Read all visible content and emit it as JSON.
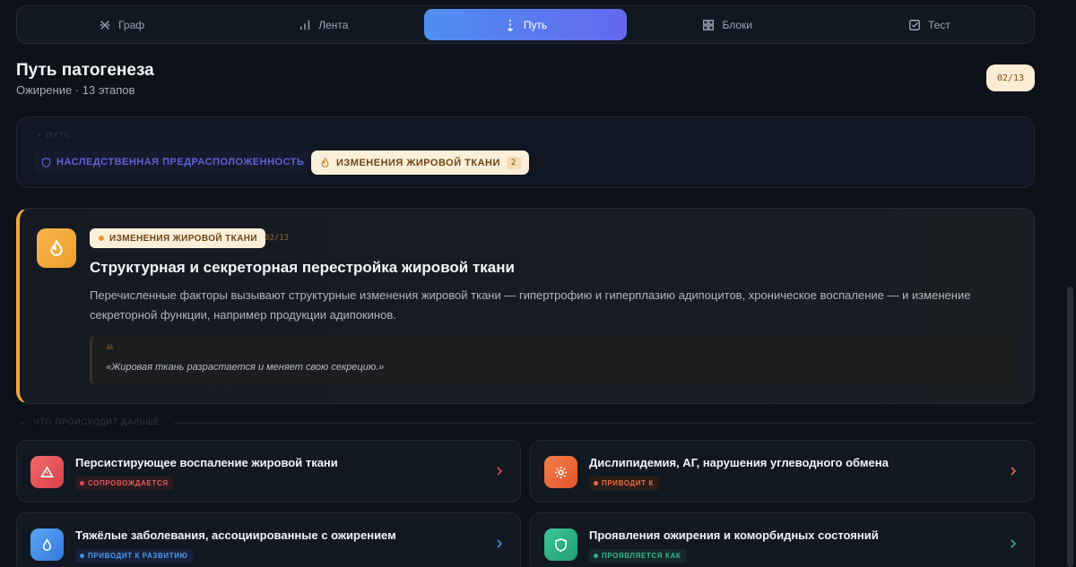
{
  "tabs": [
    {
      "label": "Граф",
      "icon": "graph-icon",
      "active": false
    },
    {
      "label": "Лента",
      "icon": "bar-chart-icon",
      "active": false
    },
    {
      "label": "Путь",
      "icon": "path-icon",
      "active": true
    },
    {
      "label": "Блоки",
      "icon": "grid-icon",
      "active": false
    },
    {
      "label": "Тест",
      "icon": "checkbox-icon",
      "active": false
    }
  ],
  "header": {
    "title": "Путь патогенеза",
    "subtitle": "Ожирение · 13 этапов",
    "counter": "02/13"
  },
  "path": {
    "label": "ПУТЬ",
    "crumbs": [
      {
        "label": "НАСЛЕДСТВЕННАЯ ПРЕДРАСПОЛОЖЕННОСТЬ",
        "icon": "shield-icon",
        "color": "#5e62d8"
      },
      {
        "label": "ИЗМЕНЕНИЯ ЖИРОВОЙ ТКАНИ",
        "icon": "flame-icon",
        "count": "2",
        "color": "#c77d24"
      }
    ]
  },
  "stage": {
    "icon": "flame-icon",
    "badge": "ИЗМЕНЕНИЯ ЖИРОВОЙ ТКАНИ",
    "number": "02/13",
    "title": "Структурная и секреторная перестройка жировой ткани",
    "text": "Перечисленные факторы вызывают структурные изменения жировой ткани — гипертрофию и гиперплазию адипоцитов, хроническое воспаление — и изменение секреторной функции, например продукции адипокинов.",
    "quote_mark": "❝",
    "quote": "«Жировая ткань разрастается и меняет свою секрецию.»",
    "accent": "#f0a63a"
  },
  "next": {
    "label": "ЧТО ПРОИСХОДИТ ДАЛЬШЕ",
    "items": [
      {
        "title": "Персистирующее воспаление жировой ткани",
        "badge": "СОПРОВОЖДАЕТСЯ",
        "icon": "warning-icon",
        "color": "#e04a4a"
      },
      {
        "title": "Дислипидемия, АГ, нарушения углеводного обмена",
        "badge": "ПРИВОДИТ К",
        "icon": "sun-icon",
        "color": "#ef6a3a"
      },
      {
        "title": "Тяжёлые заболевания, ассоциированные с ожирением",
        "badge": "ПРИВОДИТ К РАЗВИТИЮ",
        "icon": "drop-icon",
        "color": "#3d8ee8"
      },
      {
        "title": "Проявления ожирения и коморбидных состояний",
        "badge": "ПРОЯВЛЯЕТСЯ КАК",
        "icon": "shield-icon",
        "color": "#2fb386"
      }
    ]
  }
}
